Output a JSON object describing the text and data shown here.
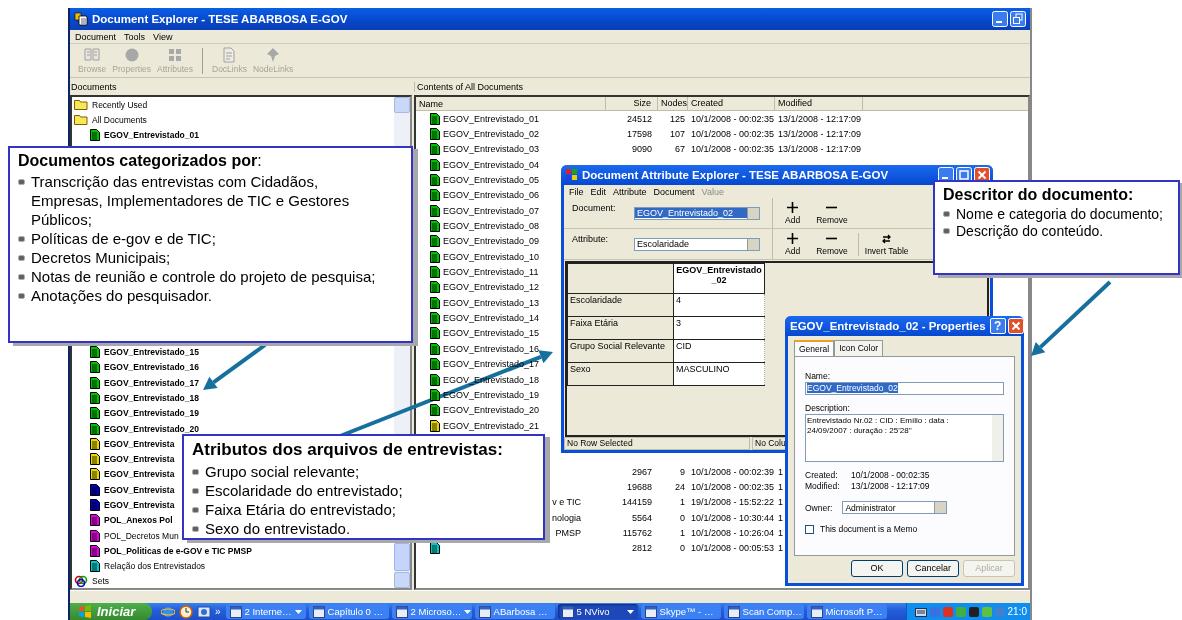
{
  "main_window": {
    "title": "Document Explorer - TESE ABARBOSA E-GOV",
    "menu": [
      {
        "label": "Document"
      },
      {
        "label": "Tools"
      },
      {
        "label": "View"
      }
    ],
    "toolbar": [
      [
        {
          "label": "Browse",
          "kind": "book",
          "disabled": true
        },
        {
          "label": "Properties",
          "kind": "dot",
          "disabled": true
        },
        {
          "label": "Attributes",
          "kind": "grid",
          "disabled": true
        }
      ],
      [
        {
          "label": "DocLinks",
          "kind": "doclink",
          "disabled": true
        },
        {
          "label": "NodeLinks",
          "kind": "pin",
          "disabled": true
        }
      ]
    ],
    "documents_pane": {
      "header": "Documents",
      "tree": [
        {
          "kind": "folder",
          "label": "Recently Used",
          "bold": false
        },
        {
          "kind": "folder",
          "label": "All Documents",
          "bold": false,
          "children": [
            {
              "kind": "document",
              "label": "EGOV_Entrevistado_01",
              "bold": true,
              "color": "#00c000"
            },
            {
              "kind": "document",
              "label": "EGOV_Entrevistado_15",
              "bold": true,
              "color": "#00c000"
            },
            {
              "kind": "document",
              "label": "EGOV_Entrevistado_16",
              "bold": true,
              "color": "#00c000"
            },
            {
              "kind": "document",
              "label": "EGOV_Entrevistado_17",
              "bold": true,
              "color": "#00c000"
            },
            {
              "kind": "document",
              "label": "EGOV_Entrevistado_18",
              "bold": true,
              "color": "#00c000"
            },
            {
              "kind": "document",
              "label": "EGOV_Entrevistado_19",
              "bold": true,
              "color": "#00c000"
            },
            {
              "kind": "document",
              "label": "EGOV_Entrevistado_20",
              "bold": true,
              "color": "#00c000"
            },
            {
              "kind": "document",
              "label": "EGOV_Entrevista",
              "bold": true,
              "color": "#e8d800"
            },
            {
              "kind": "document",
              "label": "EGOV_Entrevista",
              "bold": true,
              "color": "#e8d800"
            },
            {
              "kind": "document",
              "label": "EGOV_Entrevista",
              "bold": true,
              "color": "#e8d800"
            },
            {
              "kind": "document",
              "label": "EGOV_Entrevista",
              "bold": true,
              "color": "#0000c0"
            },
            {
              "kind": "document",
              "label": "EGOV_Entrevista",
              "bold": true,
              "color": "#0000c0"
            },
            {
              "kind": "document",
              "label": "POL_Anexos Pol",
              "bold": true,
              "color": "#e000e0"
            },
            {
              "kind": "document",
              "label": "POL_Decretos Mun",
              "bold": false,
              "color": "#e000e0"
            },
            {
              "kind": "document",
              "label": "POL_Politicas de e-GOV e TIC PMSP",
              "bold": true,
              "color": "#e000e0"
            },
            {
              "kind": "document",
              "label": "Relação dos Entrevistados",
              "bold": false,
              "color": "#00c8c8"
            }
          ]
        },
        {
          "kind": "sets",
          "label": "Sets",
          "bold": false
        }
      ]
    },
    "contents_pane": {
      "header": "Contents of All Documents",
      "columns": [
        "Name",
        "Size",
        "Nodes",
        "Created",
        "Modified"
      ],
      "rows": [
        {
          "name": "EGOV_Entrevistado_01",
          "color": "#00c000",
          "size": "24512",
          "nodes": "125",
          "created": "10/1/2008 - 00:02:35",
          "modified": "13/1/2008 - 12:17:09"
        },
        {
          "name": "EGOV_Entrevistado_02",
          "color": "#00c000",
          "size": "17598",
          "nodes": "107",
          "created": "10/1/2008 - 00:02:35",
          "modified": "13/1/2008 - 12:17:09"
        },
        {
          "name": "EGOV_Entrevistado_03",
          "color": "#00c000",
          "size": "9090",
          "nodes": "67",
          "created": "10/1/2008 - 00:02:35",
          "modified": "13/1/2008 - 12:17:09"
        },
        {
          "name": "EGOV_Entrevistado_04",
          "color": "#00c000"
        },
        {
          "name": "EGOV_Entrevistado_05",
          "color": "#00c000"
        },
        {
          "name": "EGOV_Entrevistado_06",
          "color": "#00c000"
        },
        {
          "name": "EGOV_Entrevistado_07",
          "color": "#00c000"
        },
        {
          "name": "EGOV_Entrevistado_08",
          "color": "#00c000"
        },
        {
          "name": "EGOV_Entrevistado_09",
          "color": "#00c000"
        },
        {
          "name": "EGOV_Entrevistado_10",
          "color": "#00c000"
        },
        {
          "name": "EGOV_Entrevistado_11",
          "color": "#00c000"
        },
        {
          "name": "EGOV_Entrevistado_12",
          "color": "#00c000"
        },
        {
          "name": "EGOV_Entrevistado_13",
          "color": "#00c000"
        },
        {
          "name": "EGOV_Entrevistado_14",
          "color": "#00c000"
        },
        {
          "name": "EGOV_Entrevistado_15",
          "color": "#00c000"
        },
        {
          "name": "EGOV_Entrevistado_16",
          "color": "#00c000"
        },
        {
          "name": "EGOV_Entrevistado_17",
          "color": "#00c000"
        },
        {
          "name": "EGOV_Entrevistado_18",
          "color": "#00c000"
        },
        {
          "name": "EGOV_Entrevistado_19",
          "color": "#00c000"
        },
        {
          "name": "EGOV_Entrevistado_20",
          "color": "#00c000"
        },
        {
          "name": "EGOV_Entrevistado_21",
          "color": "#e8d800"
        },
        {
          "size": "2967",
          "nodes": "9",
          "created": "10/1/2008 - 00:02:39",
          "modified": "1"
        },
        {
          "size": "19688",
          "nodes": "24",
          "created": "10/1/2008 - 00:02:35",
          "modified": "1"
        },
        {
          "name": "v e TIC",
          "clipped": true,
          "size": "144159",
          "nodes": "1",
          "created": "19/1/2008 - 15:52:22",
          "modified": "1"
        },
        {
          "name": "nologia",
          "clipped": true,
          "size": "5564",
          "nodes": "0",
          "created": "10/1/2008 - 10:30:44",
          "modified": "1"
        },
        {
          "name": "PMSP",
          "clipped": true,
          "size": "115762",
          "nodes": "1",
          "created": "10/1/2008 - 10:26:04",
          "modified": "1"
        },
        {
          "color": "#00c8c8",
          "size": "2812",
          "nodes": "0",
          "created": "10/1/2008 - 00:05:53",
          "modified": "1"
        }
      ]
    }
  },
  "attribute_explorer": {
    "title": "Document Attribute Explorer - TESE ABARBOSA E-GOV",
    "menu": [
      {
        "label": "File",
        "disabled": false
      },
      {
        "label": "Edit",
        "disabled": false
      },
      {
        "label": "Attribute",
        "disabled": false
      },
      {
        "label": "Document",
        "disabled": false
      },
      {
        "label": "Value",
        "disabled": true
      }
    ],
    "rows": [
      {
        "label": "Document:",
        "value": "EGOV_Entrevistado_02",
        "focused": true,
        "buttons": [
          {
            "kind": "add",
            "label": "Add"
          },
          {
            "kind": "remove",
            "label": "Remove"
          }
        ]
      },
      {
        "label": "Attribute:",
        "value": "Escolaridade",
        "focused": false,
        "buttons": [
          {
            "kind": "add",
            "label": "Add"
          },
          {
            "kind": "remove",
            "label": "Remove"
          },
          {
            "kind": "invert",
            "label": "Invert Table"
          }
        ]
      }
    ],
    "table": {
      "column": "EGOV_Entrevistado_02",
      "rows": [
        {
          "attribute": "Escolaridade",
          "value": "4"
        },
        {
          "attribute": "Faixa Etária",
          "value": "3"
        },
        {
          "attribute": "Grupo Social Relevante",
          "value": "CID"
        },
        {
          "attribute": "Sexo",
          "value": "MASCULINO"
        }
      ]
    },
    "status_bar": [
      "No Row Selected",
      "No Colu"
    ]
  },
  "properties_dialog": {
    "title": "EGOV_Entrevistado_02 - Properties",
    "help_button": "?",
    "tabs": [
      {
        "label": "General",
        "selected": true
      },
      {
        "label": "Icon Color",
        "selected": false
      }
    ],
    "name_label": "Name:",
    "name": "EGOV_Entrevistado_02",
    "description_label": "Description:",
    "description": "Entrevistado Nr.02 : CID : Emílio : data : 24/09/2007 : duração : 25'28''",
    "info": [
      {
        "label": "Created:",
        "value": "10/1/2008 - 00:02:35"
      },
      {
        "label": "Modified:",
        "value": "13/1/2008 - 12:17:09"
      }
    ],
    "owner_label": "Owner:",
    "owner": "Administrator",
    "memo": {
      "label": "This document is a Memo",
      "checked": false
    },
    "buttons": [
      {
        "label": "OK",
        "disabled": false
      },
      {
        "label": "Cancelar",
        "disabled": false
      },
      {
        "label": "Aplicar",
        "disabled": true
      }
    ]
  },
  "callouts": [
    {
      "title": "**Documentos categorizados por**:",
      "title_bold": false,
      "items": [
        "Transcrição das entrevistas com Cidadãos, Empresas, Implementadores de TIC e Gestores Públicos;",
        "Políticas de e-gov e de TIC;",
        "Decretos Municipais;",
        "Notas de reunião e controle do projeto de pesquisa;",
        "Anotações do pesquisador."
      ]
    },
    {
      "title": "Atributos dos arquivos de entrevistas:",
      "title_bold": true,
      "items": [
        "Grupo social relevante;",
        "Escolaridade do entrevistado;",
        "Faixa Etária do entrevistado;",
        "Sexo do entrevistado."
      ]
    },
    {
      "title": "Descritor do documento:",
      "title_bold": true,
      "items": [
        "Nome e categoria do documento;",
        "Descrição do conteúdo."
      ]
    }
  ],
  "taskbar": {
    "start": "Iniciar",
    "overflow": "»",
    "windows": [
      {
        "label": "2 Interne…",
        "selected": false,
        "menu": true
      },
      {
        "label": "Capítulo 0 …",
        "selected": false,
        "menu": false
      },
      {
        "label": "2 Microso…",
        "selected": false,
        "menu": true
      },
      {
        "label": "ABarbosa …",
        "selected": false,
        "menu": false
      },
      {
        "label": "5 NVivo",
        "selected": true,
        "menu": true
      },
      {
        "label": "Skype™ - …",
        "selected": false,
        "menu": false
      },
      {
        "label": "Scan Comp…",
        "selected": false,
        "menu": false
      },
      {
        "label": "Microsoft P…",
        "selected": false,
        "menu": false
      }
    ],
    "clock": "21:0"
  }
}
